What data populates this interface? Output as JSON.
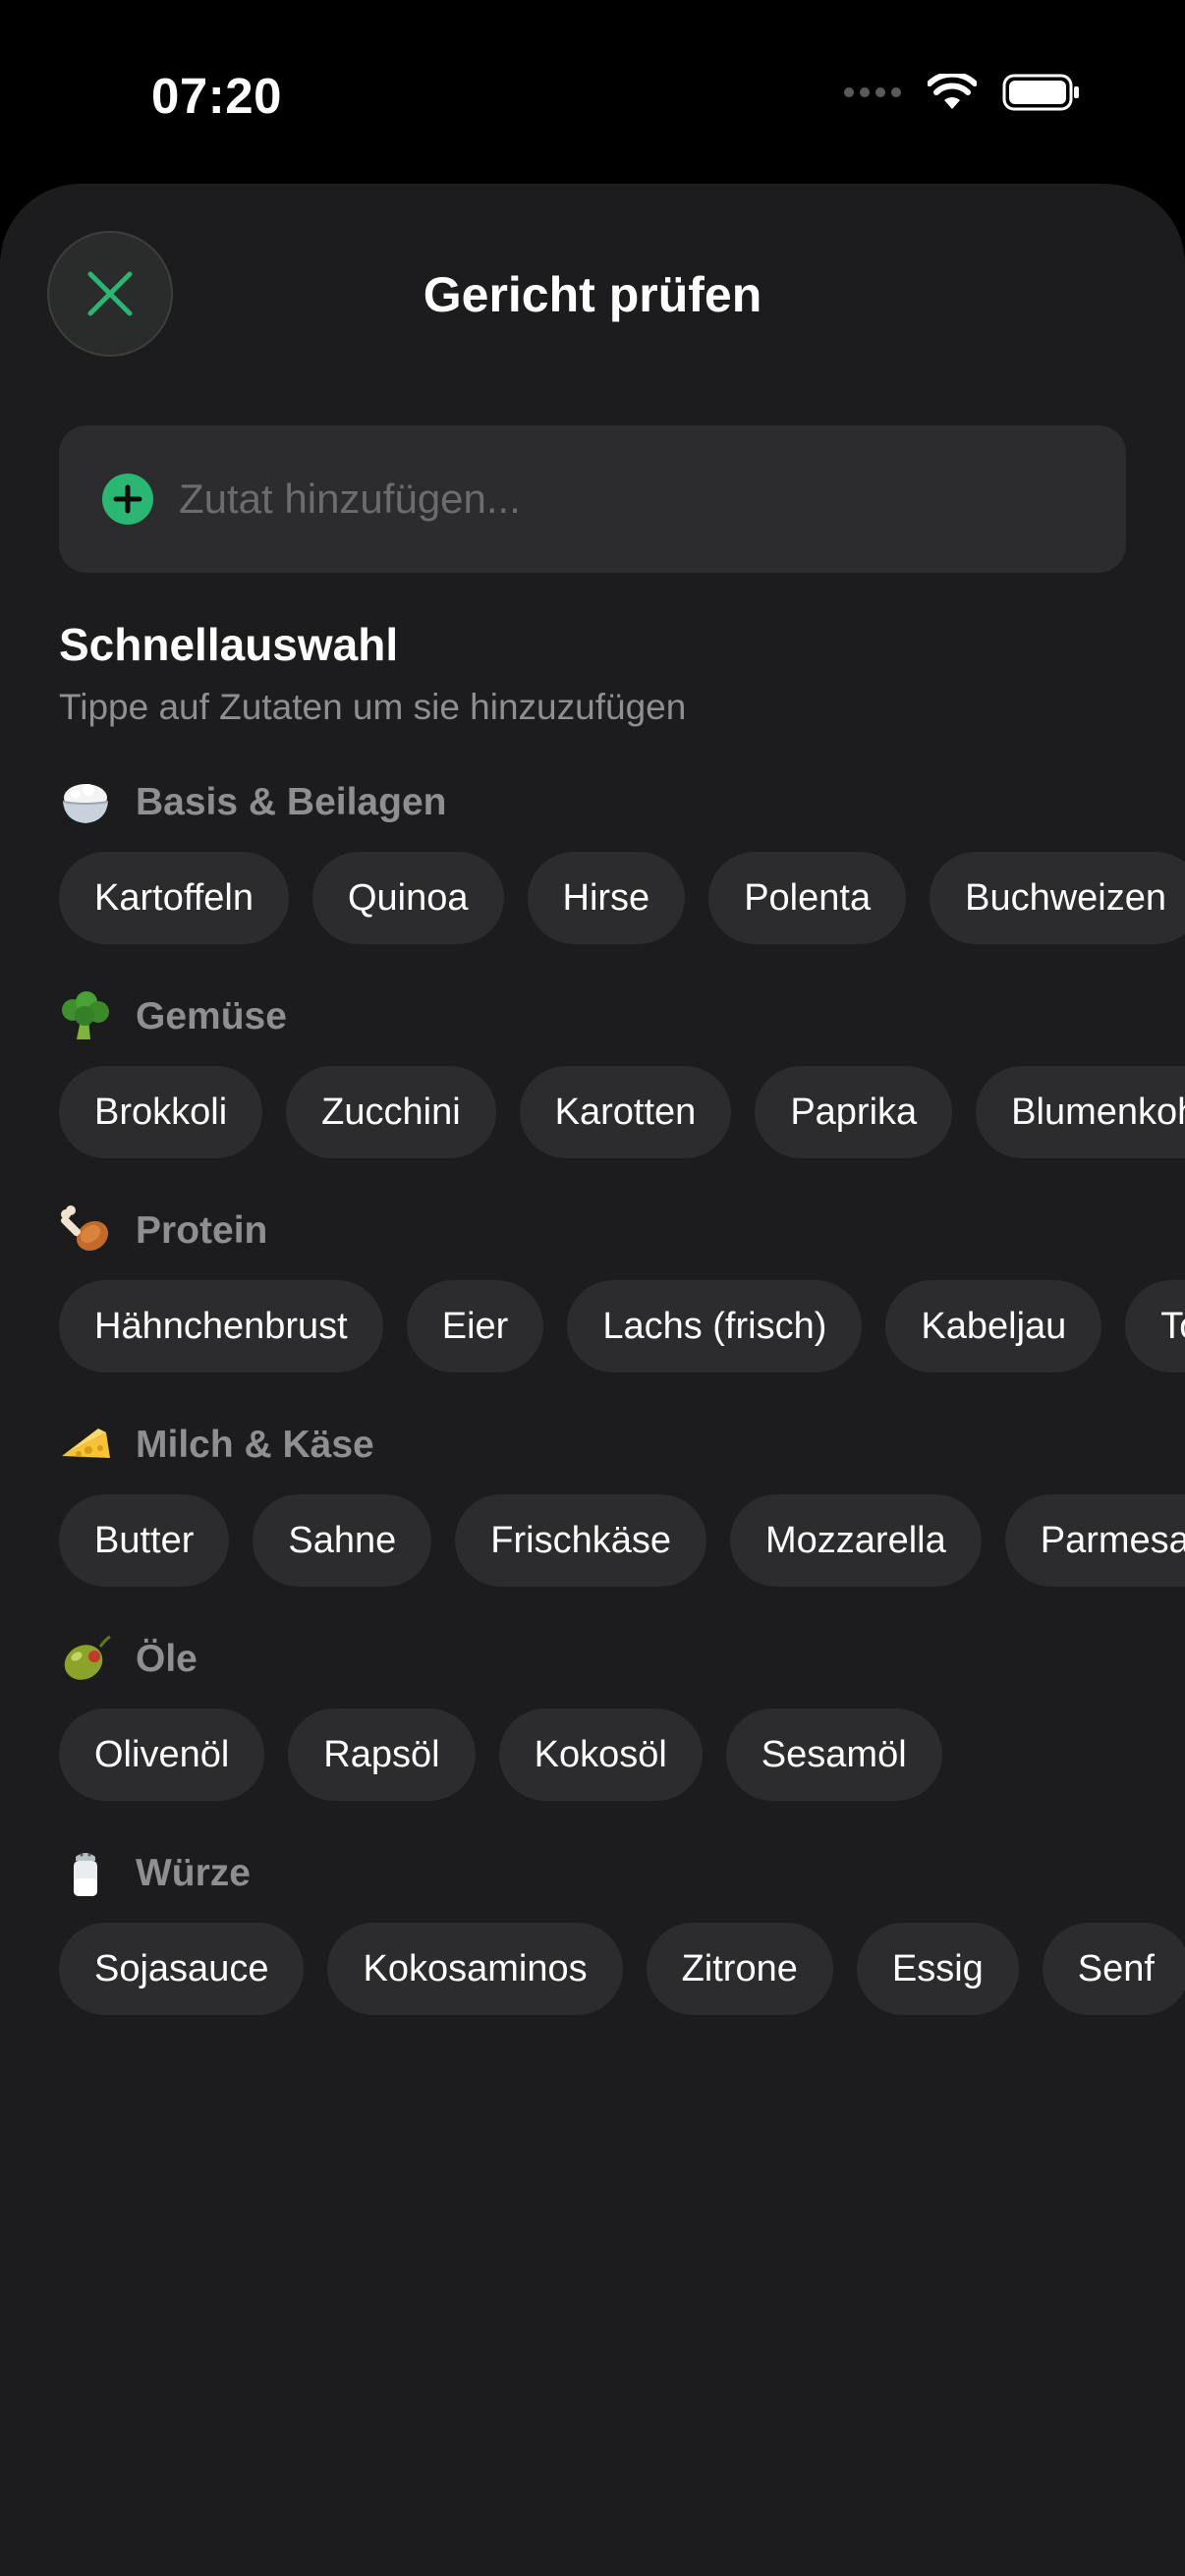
{
  "status_bar": {
    "time": "07:20"
  },
  "sheet": {
    "title": "Gericht prüfen",
    "close_icon": "close-icon",
    "accent_color": "#2bb673"
  },
  "search": {
    "placeholder": "Zutat hinzufügen...",
    "value": ""
  },
  "quick_select": {
    "title": "Schnellauswahl",
    "subtitle": "Tippe auf Zutaten um sie hinzuzufügen"
  },
  "categories": [
    {
      "name": "Basis & Beilagen",
      "icon": "rice-bowl-icon",
      "items": [
        "Kartoffeln",
        "Quinoa",
        "Hirse",
        "Polenta",
        "Buchweizen"
      ]
    },
    {
      "name": "Gemüse",
      "icon": "broccoli-icon",
      "items": [
        "Brokkoli",
        "Zucchini",
        "Karotten",
        "Paprika",
        "Blumenkohl"
      ]
    },
    {
      "name": "Protein",
      "icon": "poultry-leg-icon",
      "items": [
        "Hähnchenbrust",
        "Eier",
        "Lachs (frisch)",
        "Kabeljau",
        "Tofu"
      ]
    },
    {
      "name": "Milch & Käse",
      "icon": "cheese-icon",
      "items": [
        "Butter",
        "Sahne",
        "Frischkäse",
        "Mozzarella",
        "Parmesan"
      ]
    },
    {
      "name": "Öle",
      "icon": "olive-icon",
      "items": [
        "Olivenöl",
        "Rapsöl",
        "Kokosöl",
        "Sesamöl"
      ]
    },
    {
      "name": "Würze",
      "icon": "salt-shaker-icon",
      "items": [
        "Sojasauce",
        "Kokosaminos",
        "Zitrone",
        "Essig",
        "Senf"
      ]
    }
  ]
}
